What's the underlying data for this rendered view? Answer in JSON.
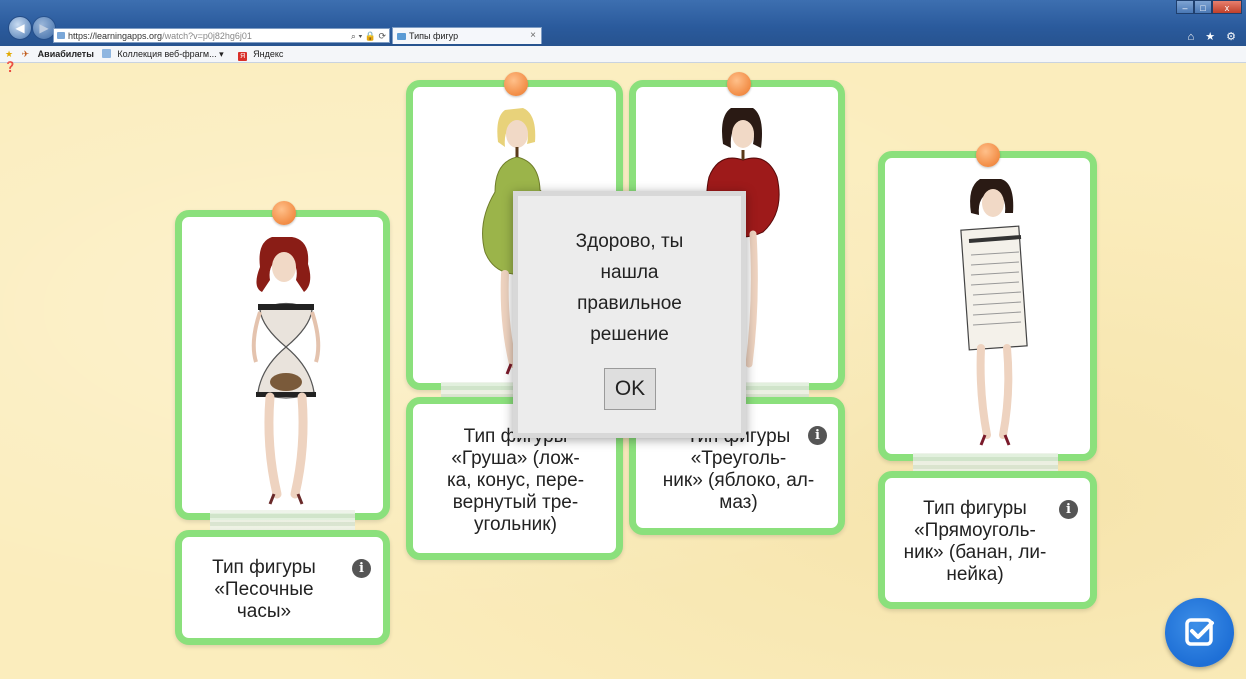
{
  "browser": {
    "url_host": "https://learningapps.org",
    "url_tail": "/watch?v=p0j82hg6j01",
    "tab_title": "Типы фигур",
    "tab_close": "×",
    "win_min": "–",
    "win_max": "□",
    "win_close": "x",
    "right_icons": "⌂ ★ ⚙",
    "favorites": [
      "Авиабилеты",
      "Коллекция веб-фрагм... ▾",
      "Яндекс"
    ]
  },
  "cards": [
    {
      "label_lines": [
        "Тип фигуры",
        "«Песочные",
        "часы»"
      ]
    },
    {
      "label_lines": [
        "Тип фигуры",
        "«Груша» (лож-",
        "ка, конус, пере-",
        "вернутый тре-",
        "угольник)"
      ]
    },
    {
      "label_lines": [
        "Тип фигуры",
        "«Треуголь-",
        "ник» (яблоко, ал-",
        "маз)"
      ]
    },
    {
      "label_lines": [
        "Тип фигуры",
        "«Прямоуголь-",
        "ник» (банан, ли-",
        "нейка)"
      ]
    }
  ],
  "info_glyph": "i",
  "modal": {
    "lines": [
      "Здорово, ты",
      "нашла",
      "правильное",
      "решение"
    ],
    "ok_label": "OK"
  },
  "colors": {
    "card_border": "#8be07c",
    "pin": "#f3904a",
    "check_button": "#1e6fd6",
    "background": "#fbedbd"
  },
  "icons": {
    "check_button": "checkbox-check-icon",
    "info": "info-icon"
  }
}
